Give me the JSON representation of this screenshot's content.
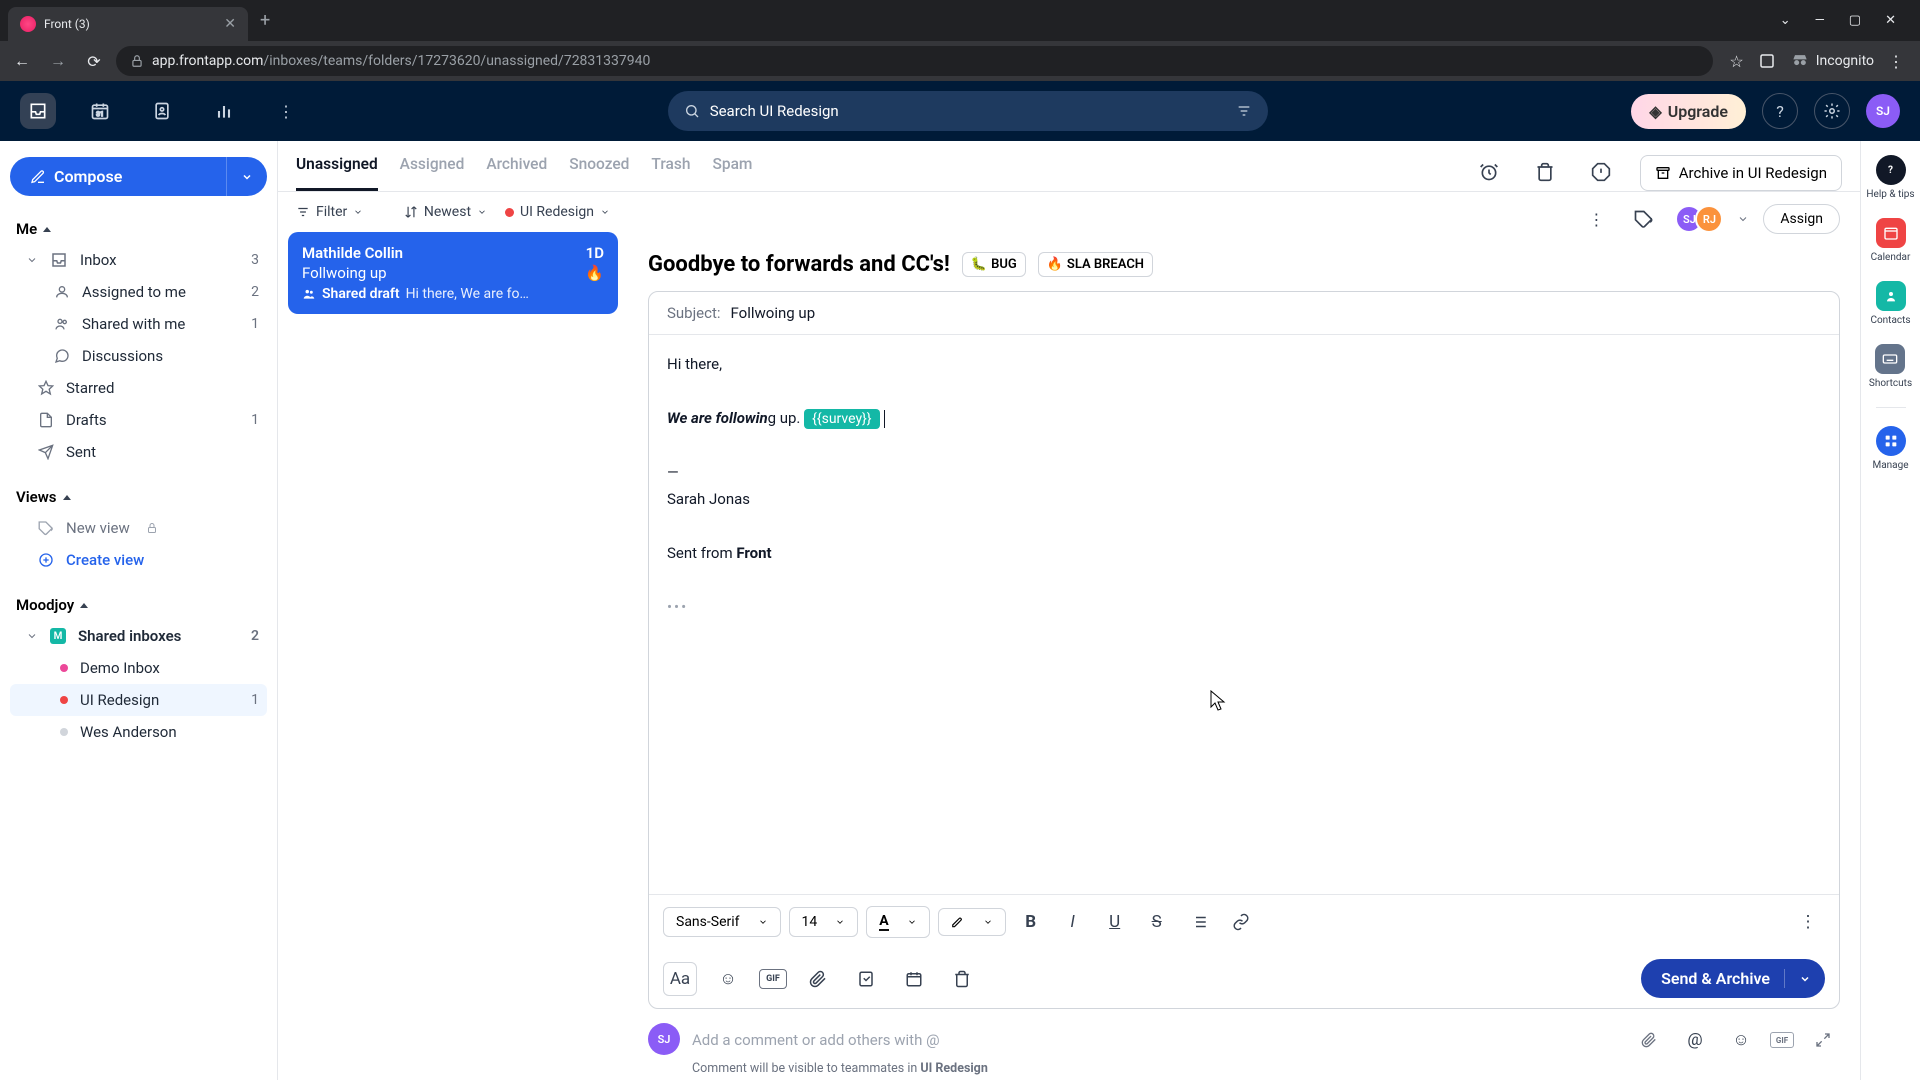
{
  "browser": {
    "tab_title": "Front (3)",
    "url_host": "app.frontapp.com",
    "url_path": "/inboxes/teams/folders/17273620/unassigned/72831337940",
    "incognito": "Incognito"
  },
  "header": {
    "search_value": "Search UI Redesign",
    "upgrade": "Upgrade"
  },
  "compose": {
    "label": "Compose"
  },
  "me_section": {
    "title": "Me",
    "items": [
      {
        "label": "Inbox",
        "count": "3"
      },
      {
        "label": "Assigned to me",
        "count": "2"
      },
      {
        "label": "Shared with me",
        "count": "1"
      },
      {
        "label": "Discussions",
        "count": ""
      },
      {
        "label": "Starred",
        "count": ""
      },
      {
        "label": "Drafts",
        "count": "1"
      },
      {
        "label": "Sent",
        "count": ""
      }
    ]
  },
  "views_section": {
    "title": "Views",
    "new_view": "New view",
    "create_view": "Create view"
  },
  "workspace": {
    "title": "Moodjoy",
    "shared_label": "Shared inboxes",
    "shared_count": "2",
    "inboxes": [
      {
        "label": "Demo Inbox",
        "count": "",
        "color": "#ec4899"
      },
      {
        "label": "UI Redesign",
        "count": "1",
        "color": "#ef4444",
        "active": true
      },
      {
        "label": "Wes Anderson",
        "count": "",
        "color": "#d1d5db"
      }
    ]
  },
  "tabs": [
    "Unassigned",
    "Assigned",
    "Archived",
    "Snoozed",
    "Trash",
    "Spam"
  ],
  "filter": {
    "filter": "Filter",
    "sort": "Newest",
    "inbox": "UI Redesign"
  },
  "conversation": {
    "sender": "Mathilde Collin",
    "age": "1D",
    "title": "Follwoing up",
    "draft_prefix": "Shared draft",
    "snippet": "Hi there, We are fo…"
  },
  "detail": {
    "archive_in": "Archive in UI Redesign",
    "assign": "Assign",
    "title": "Goodbye to forwards and CC's!",
    "tags": [
      {
        "emoji": "🐛",
        "label": "BUG"
      },
      {
        "emoji": "🔥",
        "label": "SLA BREACH"
      }
    ],
    "subject_label": "Subject:",
    "subject_value": "Follwoing up",
    "body": {
      "greeting": "Hi there,",
      "line_bold": "We are followin",
      "line_rest": "g up.",
      "variable": "{{survey}}",
      "sig_divider": "—",
      "sig_name": "Sarah Jonas",
      "sent_from": "Sent from ",
      "sent_from_app": "Front"
    },
    "format": {
      "font": "Sans-Serif",
      "size": "14"
    },
    "send": "Send & Archive"
  },
  "comment": {
    "placeholder": "Add a comment or add others with @",
    "hint_prefix": "Comment will be visible to teammates in ",
    "hint_inbox": "UI Redesign"
  },
  "avatars": {
    "me": "SJ",
    "other": "RJ"
  },
  "rail": {
    "help": "Help & tips",
    "calendar": "Calendar",
    "contacts": "Contacts",
    "shortcuts": "Shortcuts",
    "manage": "Manage"
  }
}
